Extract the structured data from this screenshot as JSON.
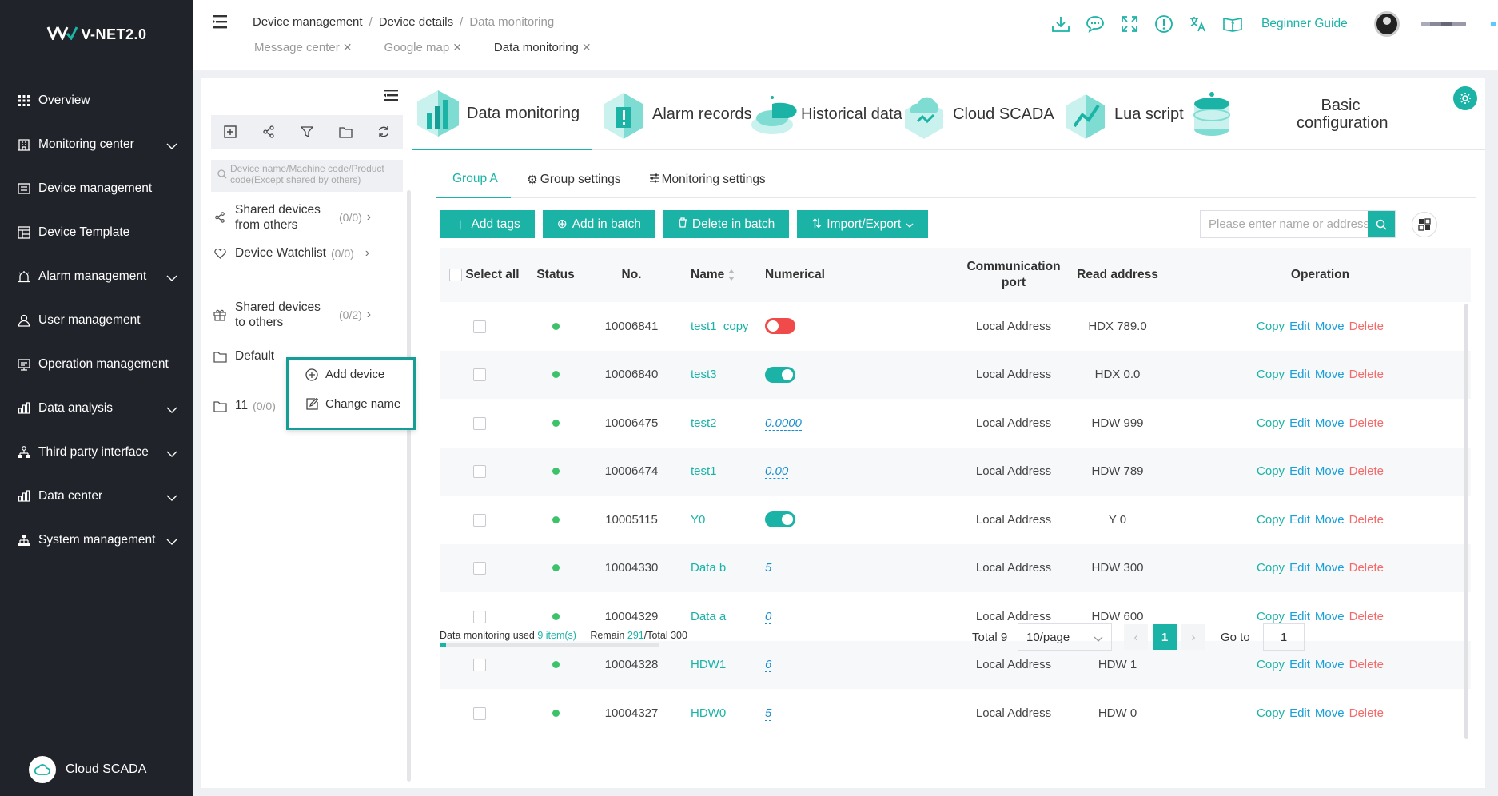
{
  "app": {
    "logo_text": "V-NET2.0"
  },
  "sidebar": {
    "items": [
      {
        "label": "Overview",
        "icon": "grid-icon",
        "chevron": false
      },
      {
        "label": "Monitoring center",
        "icon": "monitor-building-icon",
        "chevron": true
      },
      {
        "label": "Device management",
        "icon": "device-list-icon",
        "chevron": false
      },
      {
        "label": "Device Template",
        "icon": "template-icon",
        "chevron": false
      },
      {
        "label": "Alarm management",
        "icon": "alarm-icon",
        "chevron": true
      },
      {
        "label": "User management",
        "icon": "user-icon",
        "chevron": false
      },
      {
        "label": "Operation management",
        "icon": "operation-icon",
        "chevron": false
      },
      {
        "label": "Data analysis",
        "icon": "bar-chart-icon",
        "chevron": true
      },
      {
        "label": "Third party interface",
        "icon": "network-icon",
        "chevron": true
      },
      {
        "label": "Data center",
        "icon": "bar-chart-icon",
        "chevron": true
      },
      {
        "label": "System management",
        "icon": "system-tree-icon",
        "chevron": true
      }
    ],
    "footer_label": "Cloud SCADA"
  },
  "header": {
    "breadcrumb": [
      "Device management",
      "Device details",
      "Data monitoring"
    ],
    "page_tabs": [
      "Message center",
      "Google map",
      "Data monitoring"
    ],
    "beginner_guide": "Beginner Guide"
  },
  "device_panel": {
    "search_placeholder": "Device name/Machine code/Product code(Except shared by others)",
    "rows": [
      {
        "label": "Shared devices from others",
        "count": "(0/0)"
      },
      {
        "label": "Device Watchlist",
        "count": "(0/0)"
      },
      {
        "label": "Shared devices to others",
        "count": "(0/2)"
      },
      {
        "label": "Default",
        "count": ""
      },
      {
        "label": "11",
        "count": "(0/0)"
      }
    ],
    "context_menu": [
      "Add device",
      "Change name"
    ]
  },
  "feature_tabs": [
    "Data monitoring",
    "Alarm records",
    "Historical data",
    "Cloud SCADA",
    "Lua script",
    "Basic configuration"
  ],
  "sub_tabs": [
    "Group A",
    "Group settings",
    "Monitoring settings"
  ],
  "toolbar": {
    "add_tags": "Add tags",
    "add_in_batch": "Add in batch",
    "delete_in_batch": "Delete in batch",
    "import_export": "Import/Export",
    "search_placeholder": "Please enter name or address"
  },
  "table": {
    "headers": {
      "select_all": "Select all",
      "status": "Status",
      "no": "No.",
      "name": "Name",
      "numerical": "Numerical",
      "comm_port": "Communication port",
      "read_address": "Read address",
      "operation": "Operation"
    },
    "ops": {
      "copy": "Copy",
      "edit": "Edit",
      "move": "Move",
      "delete": "Delete"
    },
    "rows": [
      {
        "no": "10006841",
        "name": "test1_copy",
        "kind": "toggle",
        "value": "off",
        "port": "Local Address",
        "addr": "HDX 789.0"
      },
      {
        "no": "10006840",
        "name": "test3",
        "kind": "toggle",
        "value": "on",
        "port": "Local Address",
        "addr": "HDX 0.0"
      },
      {
        "no": "10006475",
        "name": "test2",
        "kind": "number",
        "value": "0.0000",
        "port": "Local Address",
        "addr": "HDW 999"
      },
      {
        "no": "10006474",
        "name": "test1",
        "kind": "number",
        "value": "0.00",
        "port": "Local Address",
        "addr": "HDW 789"
      },
      {
        "no": "10005115",
        "name": "Y0",
        "kind": "toggle",
        "value": "on",
        "port": "Local Address",
        "addr": "Y 0"
      },
      {
        "no": "10004330",
        "name": "Data b",
        "kind": "number",
        "value": "5",
        "port": "Local Address",
        "addr": "HDW 300"
      },
      {
        "no": "10004329",
        "name": "Data a",
        "kind": "number",
        "value": "0",
        "port": "Local Address",
        "addr": "HDW 600"
      },
      {
        "no": "10004328",
        "name": "HDW1",
        "kind": "number",
        "value": "6",
        "port": "Local Address",
        "addr": "HDW 1"
      },
      {
        "no": "10004327",
        "name": "HDW0",
        "kind": "number",
        "value": "5",
        "port": "Local Address",
        "addr": "HDW 0"
      }
    ]
  },
  "usage": {
    "prefix": "Data monitoring used",
    "used": "9 item(s)",
    "remain_label": "Remain",
    "remain": "291",
    "total": "/Total 300",
    "fraction": 0.03
  },
  "pagination": {
    "total": "Total 9",
    "page_size": "10/page",
    "current_page": "1",
    "goto_label": "Go to",
    "goto_value": "1"
  },
  "colors": {
    "accent": "#1ab3a6",
    "sidebar_bg": "#20232a",
    "danger": "#f46a6a",
    "status_online": "#3cc36a"
  }
}
